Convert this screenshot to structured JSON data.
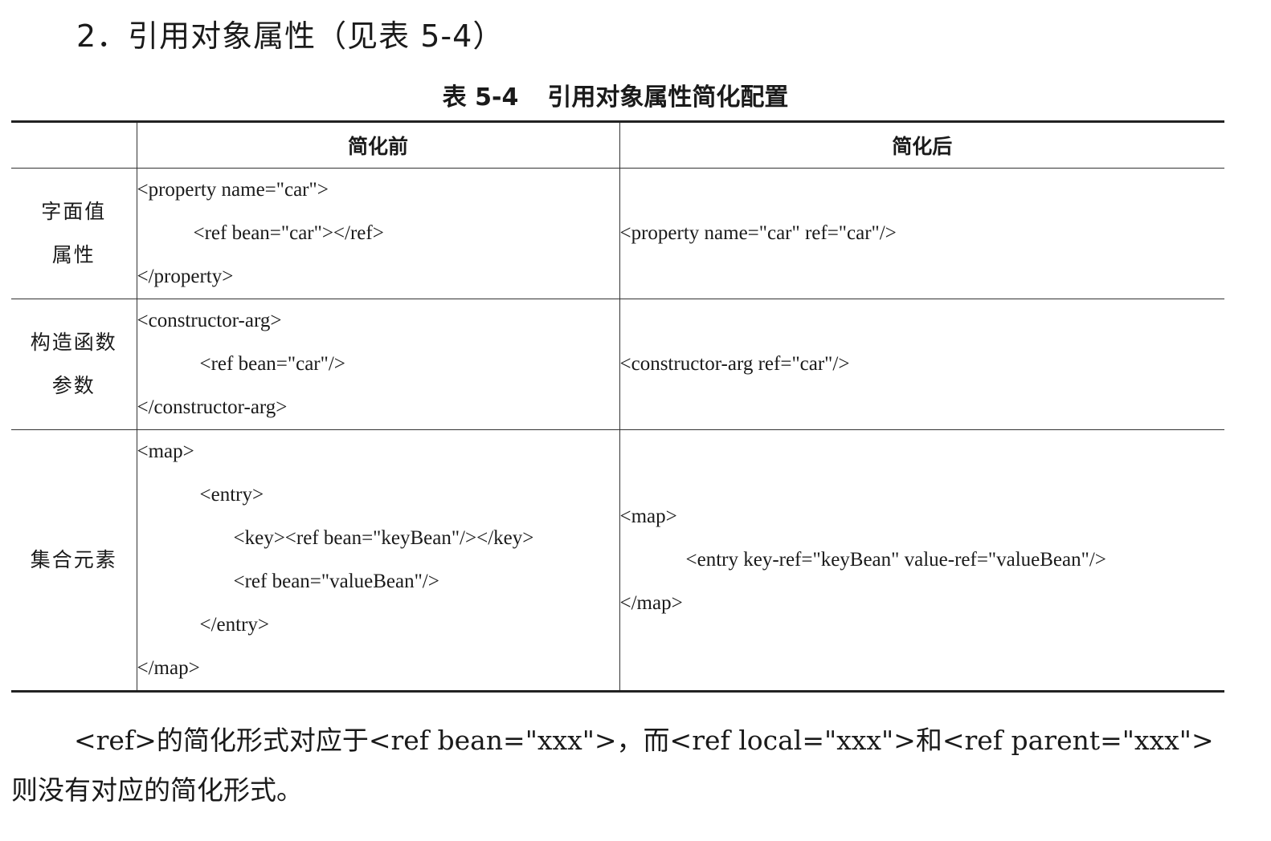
{
  "section_heading": "2．引用对象属性（见表 5-4）",
  "table": {
    "caption_number": "表 5-4",
    "caption_title": "引用对象属性简化配置",
    "headers": [
      "",
      "简化前",
      "简化后"
    ],
    "rows": [
      {
        "label_lines": [
          "字面值",
          "属性"
        ],
        "before": [
          "<property name=\"car\">",
          "<ref bean=\"car\"></ref>",
          "</property>"
        ],
        "after": [
          "<property name=\"car\" ref=\"car\"/>"
        ]
      },
      {
        "label_lines": [
          "构造函数",
          "参数"
        ],
        "before": [
          "<constructor-arg>",
          "<ref bean=\"car\"/>",
          "</constructor-arg>"
        ],
        "after": [
          "<constructor-arg ref=\"car\"/>"
        ]
      },
      {
        "label_lines": [
          "集合元素"
        ],
        "before": [
          "<map>",
          "<entry>",
          "<key><ref bean=\"keyBean\"/></key>",
          "<ref bean=\"valueBean\"/>",
          "</entry>",
          "</map>"
        ],
        "after": [
          "<map>",
          "<entry key-ref=\"keyBean\" value-ref=\"valueBean\"/>",
          "</map>"
        ]
      }
    ]
  },
  "paragraph": {
    "line1": "<ref>的简化形式对应于<ref bean=\"xxx\">，而<ref local=\"xxx\">和<ref parent=\"xxx\">",
    "line2": "则没有对应的简化形式。"
  }
}
